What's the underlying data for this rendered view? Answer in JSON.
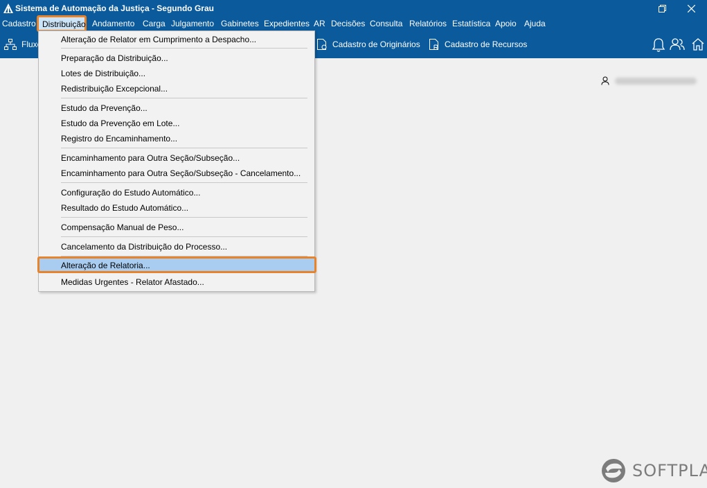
{
  "window": {
    "title": "Sistema de Automação da Justiça - Segundo Grau",
    "controls": [
      "restore-icon",
      "close-icon"
    ]
  },
  "menubar": {
    "items": [
      "Cadastro",
      "Distribuição",
      "Andamento",
      "Carga",
      "Julgamento",
      "Gabinetes",
      "Expedientes",
      "AR",
      "Decisões",
      "Consulta",
      "Relatórios",
      "Estatística",
      "Apoio",
      "Ajuda"
    ],
    "open_item": "Distribuição"
  },
  "toolbar": {
    "fluxo_label": "Fluxo",
    "originarios_label": "Cadastro de Originários",
    "recursos_label": "Cadastro de Recursos",
    "right_icons": [
      "bell-icon",
      "users-icon",
      "home-icon"
    ]
  },
  "dropdown": {
    "items": [
      "Alteração de Relator em Cumprimento a Despacho...",
      "Preparação da Distribuição...",
      "Lotes de Distribuição...",
      "Redistribuição Excepcional...",
      "Estudo da Prevenção...",
      "Estudo da Prevenção em Lote...",
      "Registro do Encaminhamento...",
      "Encaminhamento para Outra Seção/Subseção...",
      "Encaminhamento para Outra Seção/Subseção - Cancelamento...",
      "Configuração do Estudo Automático...",
      "Resultado do Estudo Automático...",
      "Compensação Manual de Peso...",
      "Cancelamento da Distribuição do Processo...",
      "Alteração de Relatoria...",
      "Medidas Urgentes - Relator Afastado..."
    ],
    "highlighted": "Alteração de Relatoria..."
  },
  "user": {
    "name": ""
  },
  "brand": {
    "logo_text": "SOFTPLAN"
  },
  "colors": {
    "titlebar": "#0a5a9c",
    "highlight_border": "#e8832a",
    "highlight_fill": "#a9cdf0",
    "menu_bg": "#f2f2f2"
  }
}
